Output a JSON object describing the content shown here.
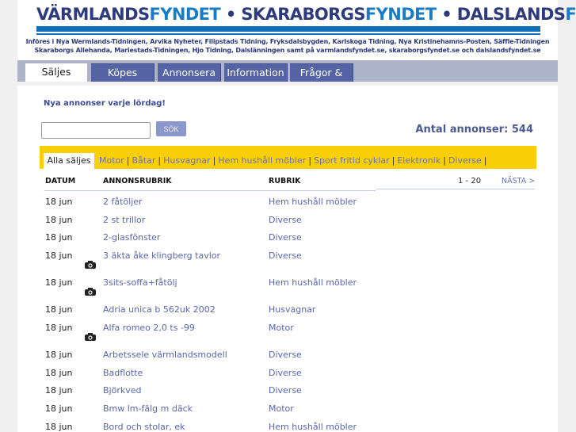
{
  "header": {
    "logo_parts": [
      "VÄRMLANDS",
      "FYNDET",
      " • SKARABORGS",
      "FYNDET",
      " • DALSLANDS",
      "FYNDET"
    ],
    "sub1": "Införes i Nya Wermlands-Tidningen, Arvika Nyheter, Filipstads Tidning, Fryksdalsbygden, Karlskoga Tidning, Nya Kristinehamns-Posten, Säffle-Tidningen",
    "sub2": "Skaraborgs Allehanda, Mariestads-Tidningen, Hjo Tidning, Dalslänningen samt på varmlandsfyndet.se, skaraborgsfyndet.se och dalslandsfyndet.se"
  },
  "tabs": [
    "Säljes",
    "Köpes",
    "Annonsera",
    "Information",
    "Frågor & svar"
  ],
  "notice": "Nya annonser varje lördag!",
  "search": {
    "value": "",
    "button": "SÖK"
  },
  "count": "Antal annonser: 544",
  "categories": {
    "active": "Alla säljes",
    "links": [
      "Motor",
      "Båtar",
      "Husvagnar",
      "Hem hushåll möbler",
      "Sport fritid cyklar",
      "Elektronik",
      "Diverse"
    ]
  },
  "table": {
    "headers": [
      "DATUM",
      "ANNONSRUBRIK",
      "RUBRIK"
    ],
    "range": "1 - 20",
    "next": "NÄSTA >",
    "rows": [
      {
        "date": "18 jun",
        "title": "2 fåtöljer",
        "cat": "Hem hushåll möbler",
        "photo": false
      },
      {
        "date": "18 jun",
        "title": "2 st trillor",
        "cat": "Diverse",
        "photo": false
      },
      {
        "date": "18 jun",
        "title": "2-glasfönster",
        "cat": "Diverse",
        "photo": false
      },
      {
        "date": "18 jun",
        "title": "3 äkta åke klingberg tavlor",
        "cat": "Diverse",
        "photo": true
      },
      {
        "date": "18 jun",
        "title": "3sits-soffa+fåtölj",
        "cat": "Hem hushåll möbler",
        "photo": true
      },
      {
        "date": "18 jun",
        "title": "Adria unica b 562uk 2002",
        "cat": "Husvagnar",
        "photo": false
      },
      {
        "date": "18 jun",
        "title": "Alfa romeo 2,0 ts -99",
        "cat": "Motor",
        "photo": true
      },
      {
        "date": "18 jun",
        "title": "Arbetssele värmlandsmodell",
        "cat": "Diverse",
        "photo": false
      },
      {
        "date": "18 jun",
        "title": "Badflotte",
        "cat": "Diverse",
        "photo": false
      },
      {
        "date": "18 jun",
        "title": "Björkved",
        "cat": "Diverse",
        "photo": false
      },
      {
        "date": "18 jun",
        "title": "Bmw lm-fälg m däck",
        "cat": "Motor",
        "photo": false
      },
      {
        "date": "18 jun",
        "title": "Bord och stolar, ek",
        "cat": "Hem hushåll möbler",
        "photo": false
      }
    ]
  }
}
